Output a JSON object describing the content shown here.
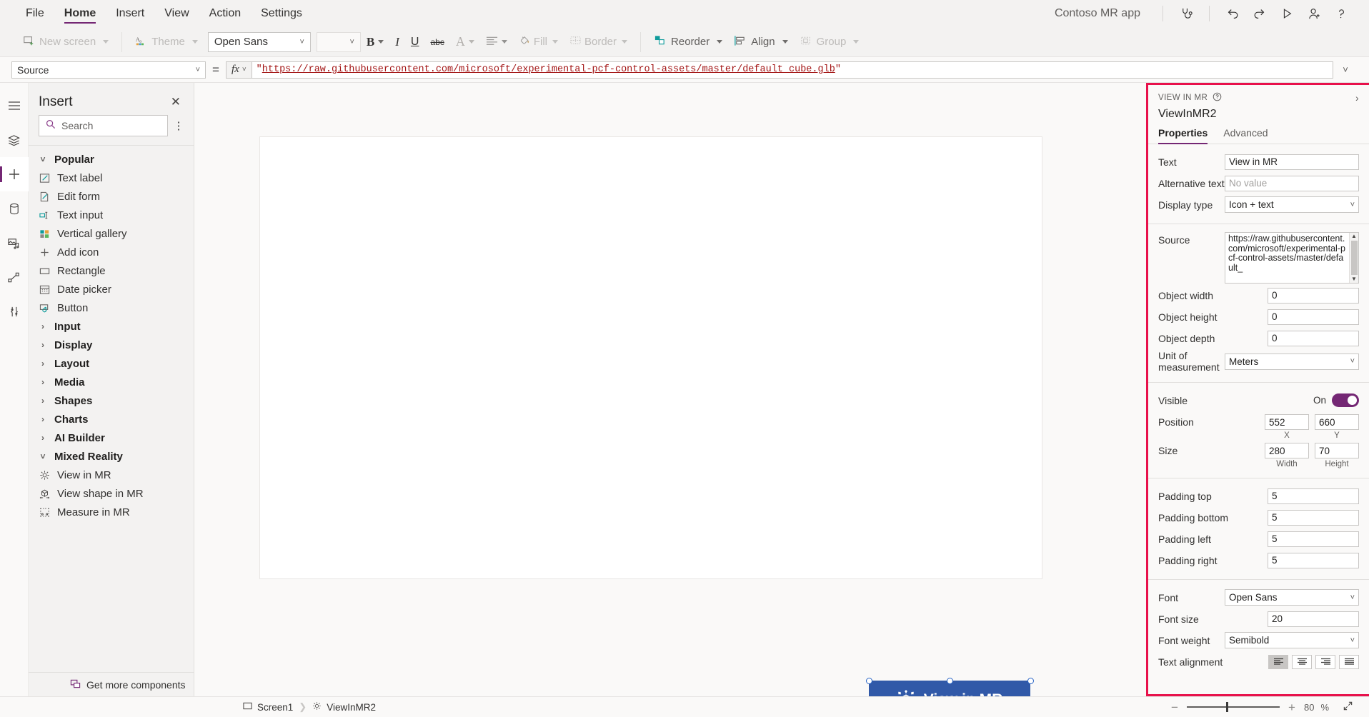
{
  "menubar": {
    "items": [
      "File",
      "Home",
      "Insert",
      "View",
      "Action",
      "Settings"
    ],
    "active": "Home",
    "app_name": "Contoso MR app",
    "icons": [
      "app-checker-icon",
      "undo-icon",
      "redo-icon",
      "play-icon",
      "share-icon",
      "help-icon"
    ]
  },
  "ribbon": {
    "new_screen": "New screen",
    "theme": "Theme",
    "font_family": "Open Sans",
    "font_size": "",
    "bold": "B",
    "italic": "I",
    "underline": "U",
    "strikethrough": "abc",
    "font_color": "A",
    "align": "align-text-icon",
    "fill": "Fill",
    "border": "Border",
    "reorder": "Reorder",
    "align_group": "Align",
    "group": "Group"
  },
  "formula_bar": {
    "property": "Source",
    "equals": "=",
    "fx": "fx",
    "formula_quote": "\"",
    "formula_url": "https://raw.githubusercontent.com/microsoft/experimental-pcf-control-assets/master/default_cube.glb",
    "formula_full": "\"https://raw.githubusercontent.com/microsoft/experimental-pcf-control-assets/master/default_cube.glb\""
  },
  "rail": {
    "items": [
      {
        "name": "hamburger-icon",
        "label": "Menu"
      },
      {
        "name": "tree-view-icon",
        "label": "Tree view"
      },
      {
        "name": "insert-icon",
        "label": "Insert"
      },
      {
        "name": "data-icon",
        "label": "Data"
      },
      {
        "name": "media-icon",
        "label": "Media"
      },
      {
        "name": "power-automate-icon",
        "label": "Power Automate"
      },
      {
        "name": "variables-icon",
        "label": "Variables"
      }
    ],
    "selected": "insert-icon"
  },
  "insert_panel": {
    "title": "Insert",
    "close": "✕",
    "search_placeholder": "Search",
    "more": "⋮",
    "groups": [
      {
        "label": "Popular",
        "expanded": true,
        "items": [
          {
            "label": "Text label",
            "icon": "text-label-icon"
          },
          {
            "label": "Edit form",
            "icon": "edit-form-icon"
          },
          {
            "label": "Text input",
            "icon": "text-input-icon"
          },
          {
            "label": "Vertical gallery",
            "icon": "vertical-gallery-icon"
          },
          {
            "label": "Add icon",
            "icon": "add-icon"
          },
          {
            "label": "Rectangle",
            "icon": "rectangle-icon"
          },
          {
            "label": "Date picker",
            "icon": "date-picker-icon"
          },
          {
            "label": "Button",
            "icon": "button-icon"
          }
        ]
      },
      {
        "label": "Input",
        "expanded": false,
        "items": []
      },
      {
        "label": "Display",
        "expanded": false,
        "items": []
      },
      {
        "label": "Layout",
        "expanded": false,
        "items": []
      },
      {
        "label": "Media",
        "expanded": false,
        "items": []
      },
      {
        "label": "Shapes",
        "expanded": false,
        "items": []
      },
      {
        "label": "Charts",
        "expanded": false,
        "items": []
      },
      {
        "label": "AI Builder",
        "expanded": false,
        "items": []
      },
      {
        "label": "Mixed Reality",
        "expanded": true,
        "items": [
          {
            "label": "View in MR",
            "icon": "view-in-mr-icon"
          },
          {
            "label": "View shape in MR",
            "icon": "view-shape-in-mr-icon"
          },
          {
            "label": "Measure in MR",
            "icon": "measure-in-mr-icon"
          }
        ]
      }
    ],
    "footer": "Get more components"
  },
  "canvas": {
    "mr_button_label": "View in MR",
    "mr_button_color": "#3159a8",
    "mr_button_icon": "view-in-mr-cube-icon"
  },
  "properties_panel": {
    "kicker": "VIEW IN MR",
    "help_icon": "help-circle-icon",
    "collapse_icon": "chevron-right-icon",
    "control_name": "ViewInMR2",
    "tabs": [
      {
        "label": "Properties",
        "active": true
      },
      {
        "label": "Advanced",
        "active": false
      }
    ],
    "accent": "#742774",
    "highlight_border": "#e8114b",
    "fields": {
      "text_label": "Text",
      "text_value": "View in MR",
      "alt_label": "Alternative text",
      "alt_placeholder": "No value",
      "display_type_label": "Display type",
      "display_type_value": "Icon + text",
      "source_label": "Source",
      "source_value": "https://raw.githubusercontent.com/microsoft/experimental-pcf-control-assets/master/default_",
      "object_width_label": "Object width",
      "object_width_value": "0",
      "object_height_label": "Object height",
      "object_height_value": "0",
      "object_depth_label": "Object depth",
      "object_depth_value": "0",
      "unit_label": "Unit of measurement",
      "unit_value": "Meters",
      "visible_label": "Visible",
      "visible_state": "On",
      "position_label": "Position",
      "position_x": "552",
      "position_y": "660",
      "position_x_sub": "X",
      "position_y_sub": "Y",
      "size_label": "Size",
      "size_w": "280",
      "size_h": "70",
      "size_w_sub": "Width",
      "size_h_sub": "Height",
      "padding_top_label": "Padding top",
      "padding_top_value": "5",
      "padding_bottom_label": "Padding bottom",
      "padding_bottom_value": "5",
      "padding_left_label": "Padding left",
      "padding_left_value": "5",
      "padding_right_label": "Padding right",
      "padding_right_value": "5",
      "font_label": "Font",
      "font_value": "Open Sans",
      "font_size_label": "Font size",
      "font_size_value": "20",
      "font_weight_label": "Font weight",
      "font_weight_value": "Semibold",
      "text_alignment_label": "Text alignment"
    }
  },
  "status_bar": {
    "screen": "Screen1",
    "control": "ViewInMR2",
    "zoom_out": "−",
    "zoom_in": "+",
    "zoom_value": "80",
    "zoom_unit": "%",
    "fit_icon": "fit-screen-icon"
  }
}
